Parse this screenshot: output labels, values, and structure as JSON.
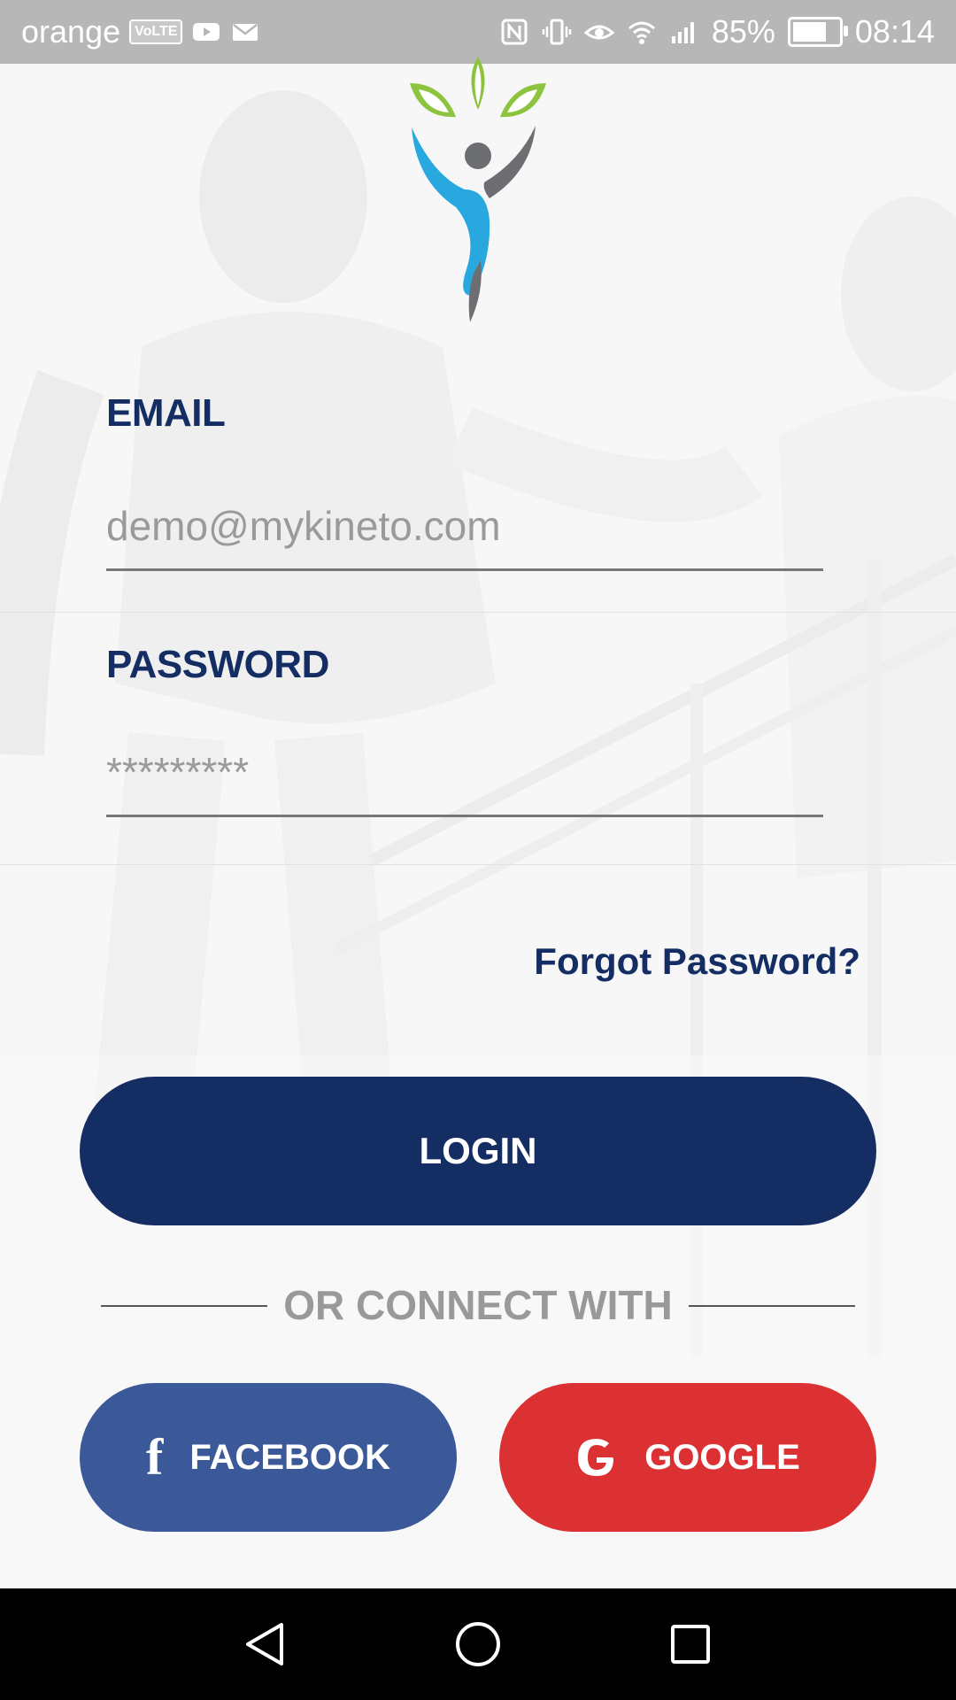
{
  "status_bar": {
    "carrier": "orange",
    "volte": "VoLTE",
    "battery_percent": "85%",
    "battery_level": 0.85,
    "time": "08:14"
  },
  "login_form": {
    "email_label": "EMAIL",
    "email_placeholder": "demo@mykineto.com",
    "password_label": "PASSWORD",
    "password_placeholder": "*********",
    "forgot_password": "Forgot Password?",
    "login_button": "LOGIN"
  },
  "social": {
    "or_connect_with": "OR CONNECT WITH",
    "facebook_label": "FACEBOOK",
    "facebook_icon_glyph": "f",
    "google_label": "GOOGLE"
  },
  "colors": {
    "primary": "#142d63",
    "facebook": "#3b5998",
    "google": "#dc3133",
    "logo_green": "#8cc43f",
    "logo_blue": "#29a8e0",
    "logo_gray": "#6d6e71"
  },
  "icons": {
    "status_left": [
      "youtube-icon",
      "mail-icon"
    ],
    "status_right": [
      "nfc-icon",
      "vibrate-icon",
      "eye-comfort-icon",
      "wifi-icon",
      "signal-icon",
      "battery-icon"
    ],
    "nav": [
      "back-icon",
      "home-icon",
      "recents-icon"
    ]
  }
}
